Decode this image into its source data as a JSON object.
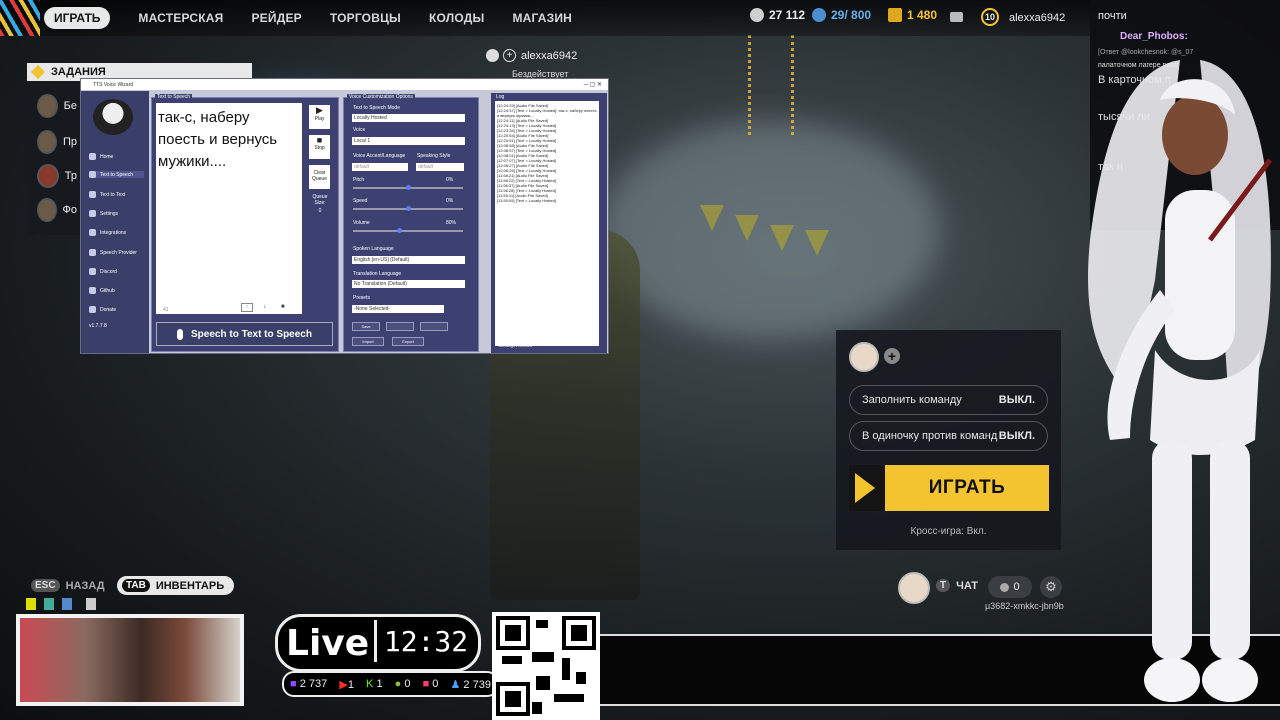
{
  "topnav": {
    "items": [
      "ИГРАТЬ",
      "МАСТЕРСКАЯ",
      "РЕЙДЕР",
      "ТОРГОВЦЫ",
      "КОЛОДЫ",
      "МАГАЗИН"
    ],
    "currencies": [
      {
        "icon": "coin-stack-icon",
        "value": "27 112",
        "color": "#e0e0e0"
      },
      {
        "icon": "blue-coin-icon",
        "value": "29/ 800",
        "color": "#6ab0e8"
      },
      {
        "icon": "gold-bars-icon",
        "value": "1 480",
        "color": "#f4c430"
      }
    ],
    "level": "10",
    "username": "alexxa6942"
  },
  "party": {
    "username": "alexxa6942",
    "status": "Бездействует"
  },
  "missions": {
    "title": "ЗАДАНИЯ",
    "rows": [
      "Бе",
      "Пр",
      "Тр",
      "Фо"
    ]
  },
  "chat": {
    "title": "почти",
    "lines": [
      {
        "user": "Dear_Phobos:",
        "text": ""
      },
      {
        "meta": "[Ответ @lookchesnok: @s_07"
      },
      {
        "text": "палаточном лагере рабо"
      },
      {
        "text": "В карточном п"
      },
      {
        "text": "тысячи ли"
      },
      {
        "text": "так н"
      }
    ]
  },
  "tts": {
    "window_title": "TTS Voice Wizard",
    "sidebar": [
      "Home",
      "Text to Speech",
      "Text to Text",
      "Settings",
      "Integrations",
      "Speech Provider",
      "Discord",
      "Github",
      "Donate"
    ],
    "version": "v1.7.7.8",
    "text_panel_title": "Text to Speech",
    "text": "так-с, наберу поесть и вернусь мужики....",
    "char_count": "41",
    "buttons": {
      "play": "Play",
      "stop": "Stop",
      "clear": "Clear Queue",
      "queue": "Queue Size:",
      "queue_value": "0"
    },
    "sts_button": "Speech to Text to Speech",
    "voice_panel_title": "Voice Customization Options",
    "mode_label": "Text to Speech Mode",
    "mode_value": "Locally Hosted",
    "voice_label": "Voice",
    "voice_value": "Local 1",
    "accent_label": "Voice Accent/Language",
    "accent_value": "default",
    "style_label": "Speaking Style",
    "style_value": "default",
    "pitch_label": "Pitch",
    "pitch_value": "0%",
    "speed_label": "Speed",
    "speed_value": "0%",
    "volume_label": "Volume",
    "volume_value": "80%",
    "spoken_label": "Spoken Language",
    "spoken_value": "English [en-US] (Default)",
    "translation_label": "Translation Language",
    "translation_value": "No Translation (Default)",
    "presets_label": "Presets",
    "presets_value": "-None Selected-",
    "save": "Save",
    "import": "Import",
    "export": "Export",
    "log_title": "Log",
    "log_lines": [
      "[12:24:29] [Audio File Saved]",
      "[12:24:37] [Text > Locally Hosted]: так-с, наберу поесть и вернусь мужики....",
      "[12:24:11] [Audio File Saved]",
      "[12:24:13] [Text > Locally Hosted]",
      "[12:23:34] [Text > Locally Hosted]",
      "[12:20:54] [Audio File Saved]",
      "[12:20:51] [Text > Locally Hosted]",
      "[12:08:58] [Audio File Saved]",
      "[12:08:57] [Text > Locally Hosted]",
      "[12:08:01] [Audio File Saved]",
      "[12:07:07] [Text > Locally Hosted]",
      "[12:06:27] [Audio File Saved]",
      "[12:06:26] [Text > Locally Hosted]",
      "[11:58:21] [Audio File Saved]",
      "[11:58:22] [Text > Locally Hosted]",
      "[11:56:37] [Audio File Saved]",
      "[11:56:28] [Text > Locally Hosted]",
      "[11:55:11] [Audio File Saved]",
      "[11:55:09] [Text > Locally Hosted]"
    ],
    "log_footer": "Messages Deleted"
  },
  "match": {
    "fill_label": "Заполнить команду",
    "fill_value": "ВЫКЛ.",
    "solo_label": "В одиночку против команд",
    "solo_value": "ВЫКЛ.",
    "play": "ИГРАТЬ",
    "crossplay": "Кросс-игра: Вкл."
  },
  "bottom": {
    "esc_key": "ESC",
    "back": "НАЗАД",
    "tab_key": "TAB",
    "inventory": "ИНВЕНТАРЬ",
    "chat_key": "T",
    "chat": "ЧАТ",
    "friends": "0",
    "code": "μ3682-xmkkc-jbn9b"
  },
  "stream": {
    "live": "Live",
    "time": "12:32",
    "stats": [
      {
        "icon": "twitch-icon",
        "value": "2 737",
        "color": "#9146ff"
      },
      {
        "icon": "youtube-icon",
        "value": "1",
        "color": "#ff2a2a"
      },
      {
        "icon": "kick-icon",
        "value": "1",
        "color": "#53fc18"
      },
      {
        "icon": "rumble-icon",
        "value": "0",
        "color": "#85c742"
      },
      {
        "icon": "vk-live-icon",
        "value": "0",
        "color": "#ff3d6e"
      },
      {
        "icon": "viewers-icon",
        "value": "2 739",
        "color": "#4a9eff"
      }
    ]
  },
  "colors": {
    "accent": "#f4c430",
    "tts_panel": "#3c4172",
    "tts_side": "#3a3f6a"
  }
}
